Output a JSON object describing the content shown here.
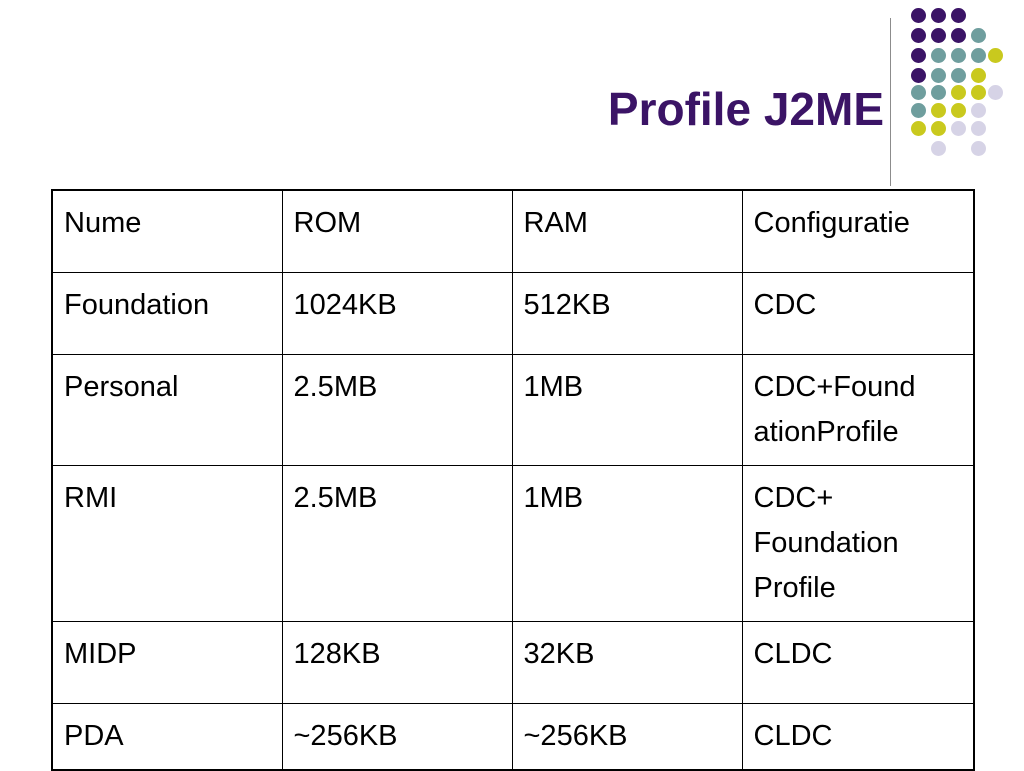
{
  "slide": {
    "title": "Profile J2ME"
  },
  "decoration": {
    "colors": {
      "purple": "#3b1466",
      "teal": "#6f9e9e",
      "yellow": "#c9c91e",
      "lavender": "#d6d3e6",
      "rule": "#8c8c8c"
    }
  },
  "table": {
    "headers": [
      "Nume",
      "ROM",
      "RAM",
      "Configuratie"
    ],
    "rows": [
      [
        "Foundation",
        "1024KB",
        "512KB",
        "CDC"
      ],
      [
        "Personal",
        "2.5MB",
        "1MB",
        "CDC+Found\nationProfile"
      ],
      [
        "RMI",
        "2.5MB",
        "1MB",
        "CDC+\nFoundation\nProfile"
      ],
      [
        "MIDP",
        "128KB",
        "32KB",
        "CLDC"
      ],
      [
        "PDA",
        "~256KB",
        "~256KB",
        "CLDC"
      ]
    ]
  }
}
